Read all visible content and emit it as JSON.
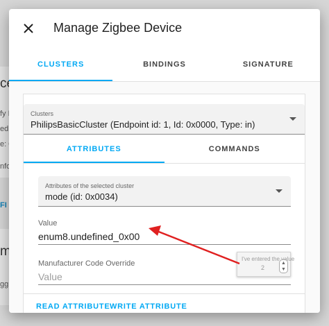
{
  "dialog": {
    "title": "Manage Zigbee Device",
    "tabs": [
      {
        "label": "CLUSTERS",
        "active": true
      },
      {
        "label": "BINDINGS",
        "active": false
      },
      {
        "label": "SIGNATURE",
        "active": false
      }
    ]
  },
  "clusters_select": {
    "label": "Clusters",
    "value": "PhilipsBasicCluster (Endpoint id: 1, Id: 0x0000, Type: in)"
  },
  "subtabs": [
    {
      "label": "ATTRIBUTES",
      "active": true
    },
    {
      "label": "COMMANDS",
      "active": false
    }
  ],
  "attributes_select": {
    "label": "Attributes of the selected cluster",
    "value": "mode (id: 0x0034)"
  },
  "value_field": {
    "label": "Value",
    "value": "enum8.undefined_0x00"
  },
  "manufacturer_field": {
    "label": "Manufacturer Code Override",
    "placeholder": "Value"
  },
  "actions": {
    "read": "READ ATTRIBUTE",
    "write": "WRITE ATTRIBUTE"
  },
  "annotation": {
    "text": "I've entered the value",
    "value": "2"
  },
  "colors": {
    "accent": "#03a9f4",
    "arrow": "#e02020"
  }
}
